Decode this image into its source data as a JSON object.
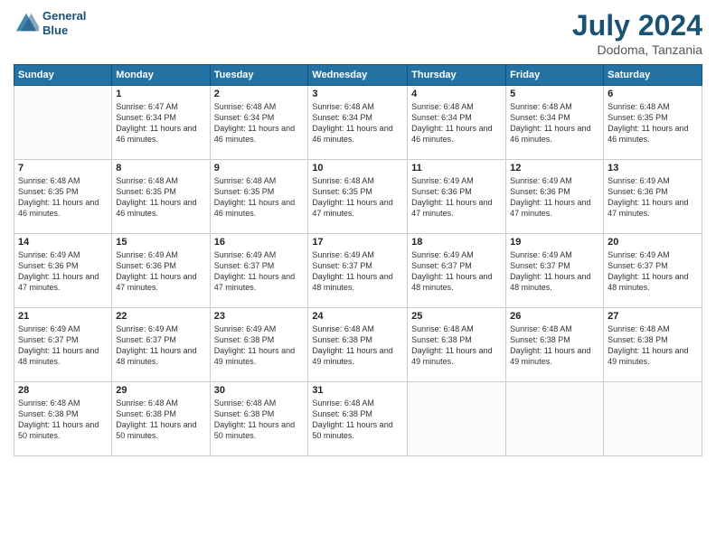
{
  "logo": {
    "line1": "General",
    "line2": "Blue"
  },
  "title": "July 2024",
  "subtitle": "Dodoma, Tanzania",
  "days_of_week": [
    "Sunday",
    "Monday",
    "Tuesday",
    "Wednesday",
    "Thursday",
    "Friday",
    "Saturday"
  ],
  "weeks": [
    [
      {
        "day": "",
        "sunrise": "",
        "sunset": "",
        "daylight": ""
      },
      {
        "day": "1",
        "sunrise": "Sunrise: 6:47 AM",
        "sunset": "Sunset: 6:34 PM",
        "daylight": "Daylight: 11 hours and 46 minutes."
      },
      {
        "day": "2",
        "sunrise": "Sunrise: 6:48 AM",
        "sunset": "Sunset: 6:34 PM",
        "daylight": "Daylight: 11 hours and 46 minutes."
      },
      {
        "day": "3",
        "sunrise": "Sunrise: 6:48 AM",
        "sunset": "Sunset: 6:34 PM",
        "daylight": "Daylight: 11 hours and 46 minutes."
      },
      {
        "day": "4",
        "sunrise": "Sunrise: 6:48 AM",
        "sunset": "Sunset: 6:34 PM",
        "daylight": "Daylight: 11 hours and 46 minutes."
      },
      {
        "day": "5",
        "sunrise": "Sunrise: 6:48 AM",
        "sunset": "Sunset: 6:34 PM",
        "daylight": "Daylight: 11 hours and 46 minutes."
      },
      {
        "day": "6",
        "sunrise": "Sunrise: 6:48 AM",
        "sunset": "Sunset: 6:35 PM",
        "daylight": "Daylight: 11 hours and 46 minutes."
      }
    ],
    [
      {
        "day": "7",
        "sunrise": "Sunrise: 6:48 AM",
        "sunset": "Sunset: 6:35 PM",
        "daylight": "Daylight: 11 hours and 46 minutes."
      },
      {
        "day": "8",
        "sunrise": "Sunrise: 6:48 AM",
        "sunset": "Sunset: 6:35 PM",
        "daylight": "Daylight: 11 hours and 46 minutes."
      },
      {
        "day": "9",
        "sunrise": "Sunrise: 6:48 AM",
        "sunset": "Sunset: 6:35 PM",
        "daylight": "Daylight: 11 hours and 46 minutes."
      },
      {
        "day": "10",
        "sunrise": "Sunrise: 6:48 AM",
        "sunset": "Sunset: 6:35 PM",
        "daylight": "Daylight: 11 hours and 47 minutes."
      },
      {
        "day": "11",
        "sunrise": "Sunrise: 6:49 AM",
        "sunset": "Sunset: 6:36 PM",
        "daylight": "Daylight: 11 hours and 47 minutes."
      },
      {
        "day": "12",
        "sunrise": "Sunrise: 6:49 AM",
        "sunset": "Sunset: 6:36 PM",
        "daylight": "Daylight: 11 hours and 47 minutes."
      },
      {
        "day": "13",
        "sunrise": "Sunrise: 6:49 AM",
        "sunset": "Sunset: 6:36 PM",
        "daylight": "Daylight: 11 hours and 47 minutes."
      }
    ],
    [
      {
        "day": "14",
        "sunrise": "Sunrise: 6:49 AM",
        "sunset": "Sunset: 6:36 PM",
        "daylight": "Daylight: 11 hours and 47 minutes."
      },
      {
        "day": "15",
        "sunrise": "Sunrise: 6:49 AM",
        "sunset": "Sunset: 6:36 PM",
        "daylight": "Daylight: 11 hours and 47 minutes."
      },
      {
        "day": "16",
        "sunrise": "Sunrise: 6:49 AM",
        "sunset": "Sunset: 6:37 PM",
        "daylight": "Daylight: 11 hours and 47 minutes."
      },
      {
        "day": "17",
        "sunrise": "Sunrise: 6:49 AM",
        "sunset": "Sunset: 6:37 PM",
        "daylight": "Daylight: 11 hours and 48 minutes."
      },
      {
        "day": "18",
        "sunrise": "Sunrise: 6:49 AM",
        "sunset": "Sunset: 6:37 PM",
        "daylight": "Daylight: 11 hours and 48 minutes."
      },
      {
        "day": "19",
        "sunrise": "Sunrise: 6:49 AM",
        "sunset": "Sunset: 6:37 PM",
        "daylight": "Daylight: 11 hours and 48 minutes."
      },
      {
        "day": "20",
        "sunrise": "Sunrise: 6:49 AM",
        "sunset": "Sunset: 6:37 PM",
        "daylight": "Daylight: 11 hours and 48 minutes."
      }
    ],
    [
      {
        "day": "21",
        "sunrise": "Sunrise: 6:49 AM",
        "sunset": "Sunset: 6:37 PM",
        "daylight": "Daylight: 11 hours and 48 minutes."
      },
      {
        "day": "22",
        "sunrise": "Sunrise: 6:49 AM",
        "sunset": "Sunset: 6:37 PM",
        "daylight": "Daylight: 11 hours and 48 minutes."
      },
      {
        "day": "23",
        "sunrise": "Sunrise: 6:49 AM",
        "sunset": "Sunset: 6:38 PM",
        "daylight": "Daylight: 11 hours and 49 minutes."
      },
      {
        "day": "24",
        "sunrise": "Sunrise: 6:48 AM",
        "sunset": "Sunset: 6:38 PM",
        "daylight": "Daylight: 11 hours and 49 minutes."
      },
      {
        "day": "25",
        "sunrise": "Sunrise: 6:48 AM",
        "sunset": "Sunset: 6:38 PM",
        "daylight": "Daylight: 11 hours and 49 minutes."
      },
      {
        "day": "26",
        "sunrise": "Sunrise: 6:48 AM",
        "sunset": "Sunset: 6:38 PM",
        "daylight": "Daylight: 11 hours and 49 minutes."
      },
      {
        "day": "27",
        "sunrise": "Sunrise: 6:48 AM",
        "sunset": "Sunset: 6:38 PM",
        "daylight": "Daylight: 11 hours and 49 minutes."
      }
    ],
    [
      {
        "day": "28",
        "sunrise": "Sunrise: 6:48 AM",
        "sunset": "Sunset: 6:38 PM",
        "daylight": "Daylight: 11 hours and 50 minutes."
      },
      {
        "day": "29",
        "sunrise": "Sunrise: 6:48 AM",
        "sunset": "Sunset: 6:38 PM",
        "daylight": "Daylight: 11 hours and 50 minutes."
      },
      {
        "day": "30",
        "sunrise": "Sunrise: 6:48 AM",
        "sunset": "Sunset: 6:38 PM",
        "daylight": "Daylight: 11 hours and 50 minutes."
      },
      {
        "day": "31",
        "sunrise": "Sunrise: 6:48 AM",
        "sunset": "Sunset: 6:38 PM",
        "daylight": "Daylight: 11 hours and 50 minutes."
      },
      {
        "day": "",
        "sunrise": "",
        "sunset": "",
        "daylight": ""
      },
      {
        "day": "",
        "sunrise": "",
        "sunset": "",
        "daylight": ""
      },
      {
        "day": "",
        "sunrise": "",
        "sunset": "",
        "daylight": ""
      }
    ]
  ]
}
